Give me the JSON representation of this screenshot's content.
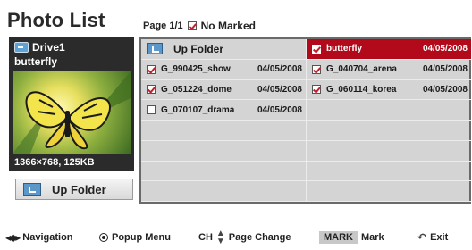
{
  "header": {
    "title": "Photo List",
    "page": "Page 1/1",
    "marked_status": "No Marked"
  },
  "preview": {
    "drive": "Drive1",
    "filename": "butterfly",
    "info": "1366×768, 125KB"
  },
  "left_button": {
    "label": "Up Folder"
  },
  "grid": {
    "up_folder_label": "Up Folder",
    "items": [
      {
        "name": "butterfly",
        "date": "04/05/2008",
        "marked": true,
        "selected": true
      },
      {
        "name": "G_990425_show",
        "date": "04/05/2008",
        "marked": true,
        "selected": false
      },
      {
        "name": "G_040704_arena",
        "date": "04/05/2008",
        "marked": true,
        "selected": false
      },
      {
        "name": "G_051224_dome",
        "date": "04/05/2008",
        "marked": true,
        "selected": false
      },
      {
        "name": "G_060114_korea",
        "date": "04/05/2008",
        "marked": true,
        "selected": false
      },
      {
        "name": "G_070107_drama",
        "date": "04/05/2008",
        "marked": false,
        "selected": false
      }
    ]
  },
  "footer": {
    "navigation": "Navigation",
    "popup": "Popup Menu",
    "ch_key": "CH",
    "page_change": "Page Change",
    "mark_key": "MARK",
    "mark": "Mark",
    "exit": "Exit"
  },
  "colors": {
    "selected_bg": "#b20a1a",
    "grid_bg": "#d4d4d4",
    "check_mark": "#c0202a"
  },
  "icons": {
    "drive": "usb-drive-icon",
    "folder": "up-folder-icon",
    "navigation": "four-way-arrows-icon",
    "popup": "ok-button-icon",
    "ch": "up-down-chevron-icon",
    "exit": "return-icon"
  }
}
